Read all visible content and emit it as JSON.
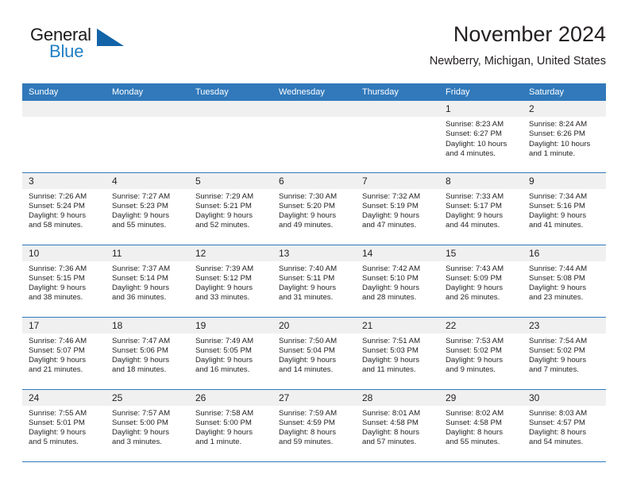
{
  "brand": {
    "name_part1": "General",
    "name_part2": "Blue",
    "logo_icon": "triangle-logo-icon"
  },
  "header": {
    "title": "November 2024",
    "subtitle": "Newberry, Michigan, United States"
  },
  "colors": {
    "header_blue": "#3179bb",
    "logo_blue": "#1263a8",
    "brand_blue_text": "#1f7fc4",
    "daynum_band": "#f0f0f0",
    "text": "#231f20"
  },
  "calendar": {
    "weekday_headers": [
      "Sunday",
      "Monday",
      "Tuesday",
      "Wednesday",
      "Thursday",
      "Friday",
      "Saturday"
    ],
    "labels": {
      "sunrise": "Sunrise:",
      "sunset": "Sunset:",
      "daylight": "Daylight:"
    },
    "weeks": [
      [
        {
          "day": "",
          "blank": true
        },
        {
          "day": "",
          "blank": true
        },
        {
          "day": "",
          "blank": true
        },
        {
          "day": "",
          "blank": true
        },
        {
          "day": "",
          "blank": true
        },
        {
          "day": "1",
          "sunrise": "Sunrise: 8:23 AM",
          "sunset": "Sunset: 6:27 PM",
          "daylight_line1": "Daylight: 10 hours",
          "daylight_line2": "and 4 minutes."
        },
        {
          "day": "2",
          "sunrise": "Sunrise: 8:24 AM",
          "sunset": "Sunset: 6:26 PM",
          "daylight_line1": "Daylight: 10 hours",
          "daylight_line2": "and 1 minute."
        }
      ],
      [
        {
          "day": "3",
          "sunrise": "Sunrise: 7:26 AM",
          "sunset": "Sunset: 5:24 PM",
          "daylight_line1": "Daylight: 9 hours",
          "daylight_line2": "and 58 minutes."
        },
        {
          "day": "4",
          "sunrise": "Sunrise: 7:27 AM",
          "sunset": "Sunset: 5:23 PM",
          "daylight_line1": "Daylight: 9 hours",
          "daylight_line2": "and 55 minutes."
        },
        {
          "day": "5",
          "sunrise": "Sunrise: 7:29 AM",
          "sunset": "Sunset: 5:21 PM",
          "daylight_line1": "Daylight: 9 hours",
          "daylight_line2": "and 52 minutes."
        },
        {
          "day": "6",
          "sunrise": "Sunrise: 7:30 AM",
          "sunset": "Sunset: 5:20 PM",
          "daylight_line1": "Daylight: 9 hours",
          "daylight_line2": "and 49 minutes."
        },
        {
          "day": "7",
          "sunrise": "Sunrise: 7:32 AM",
          "sunset": "Sunset: 5:19 PM",
          "daylight_line1": "Daylight: 9 hours",
          "daylight_line2": "and 47 minutes."
        },
        {
          "day": "8",
          "sunrise": "Sunrise: 7:33 AM",
          "sunset": "Sunset: 5:17 PM",
          "daylight_line1": "Daylight: 9 hours",
          "daylight_line2": "and 44 minutes."
        },
        {
          "day": "9",
          "sunrise": "Sunrise: 7:34 AM",
          "sunset": "Sunset: 5:16 PM",
          "daylight_line1": "Daylight: 9 hours",
          "daylight_line2": "and 41 minutes."
        }
      ],
      [
        {
          "day": "10",
          "sunrise": "Sunrise: 7:36 AM",
          "sunset": "Sunset: 5:15 PM",
          "daylight_line1": "Daylight: 9 hours",
          "daylight_line2": "and 38 minutes."
        },
        {
          "day": "11",
          "sunrise": "Sunrise: 7:37 AM",
          "sunset": "Sunset: 5:14 PM",
          "daylight_line1": "Daylight: 9 hours",
          "daylight_line2": "and 36 minutes."
        },
        {
          "day": "12",
          "sunrise": "Sunrise: 7:39 AM",
          "sunset": "Sunset: 5:12 PM",
          "daylight_line1": "Daylight: 9 hours",
          "daylight_line2": "and 33 minutes."
        },
        {
          "day": "13",
          "sunrise": "Sunrise: 7:40 AM",
          "sunset": "Sunset: 5:11 PM",
          "daylight_line1": "Daylight: 9 hours",
          "daylight_line2": "and 31 minutes."
        },
        {
          "day": "14",
          "sunrise": "Sunrise: 7:42 AM",
          "sunset": "Sunset: 5:10 PM",
          "daylight_line1": "Daylight: 9 hours",
          "daylight_line2": "and 28 minutes."
        },
        {
          "day": "15",
          "sunrise": "Sunrise: 7:43 AM",
          "sunset": "Sunset: 5:09 PM",
          "daylight_line1": "Daylight: 9 hours",
          "daylight_line2": "and 26 minutes."
        },
        {
          "day": "16",
          "sunrise": "Sunrise: 7:44 AM",
          "sunset": "Sunset: 5:08 PM",
          "daylight_line1": "Daylight: 9 hours",
          "daylight_line2": "and 23 minutes."
        }
      ],
      [
        {
          "day": "17",
          "sunrise": "Sunrise: 7:46 AM",
          "sunset": "Sunset: 5:07 PM",
          "daylight_line1": "Daylight: 9 hours",
          "daylight_line2": "and 21 minutes."
        },
        {
          "day": "18",
          "sunrise": "Sunrise: 7:47 AM",
          "sunset": "Sunset: 5:06 PM",
          "daylight_line1": "Daylight: 9 hours",
          "daylight_line2": "and 18 minutes."
        },
        {
          "day": "19",
          "sunrise": "Sunrise: 7:49 AM",
          "sunset": "Sunset: 5:05 PM",
          "daylight_line1": "Daylight: 9 hours",
          "daylight_line2": "and 16 minutes."
        },
        {
          "day": "20",
          "sunrise": "Sunrise: 7:50 AM",
          "sunset": "Sunset: 5:04 PM",
          "daylight_line1": "Daylight: 9 hours",
          "daylight_line2": "and 14 minutes."
        },
        {
          "day": "21",
          "sunrise": "Sunrise: 7:51 AM",
          "sunset": "Sunset: 5:03 PM",
          "daylight_line1": "Daylight: 9 hours",
          "daylight_line2": "and 11 minutes."
        },
        {
          "day": "22",
          "sunrise": "Sunrise: 7:53 AM",
          "sunset": "Sunset: 5:02 PM",
          "daylight_line1": "Daylight: 9 hours",
          "daylight_line2": "and 9 minutes."
        },
        {
          "day": "23",
          "sunrise": "Sunrise: 7:54 AM",
          "sunset": "Sunset: 5:02 PM",
          "daylight_line1": "Daylight: 9 hours",
          "daylight_line2": "and 7 minutes."
        }
      ],
      [
        {
          "day": "24",
          "sunrise": "Sunrise: 7:55 AM",
          "sunset": "Sunset: 5:01 PM",
          "daylight_line1": "Daylight: 9 hours",
          "daylight_line2": "and 5 minutes."
        },
        {
          "day": "25",
          "sunrise": "Sunrise: 7:57 AM",
          "sunset": "Sunset: 5:00 PM",
          "daylight_line1": "Daylight: 9 hours",
          "daylight_line2": "and 3 minutes."
        },
        {
          "day": "26",
          "sunrise": "Sunrise: 7:58 AM",
          "sunset": "Sunset: 5:00 PM",
          "daylight_line1": "Daylight: 9 hours",
          "daylight_line2": "and 1 minute."
        },
        {
          "day": "27",
          "sunrise": "Sunrise: 7:59 AM",
          "sunset": "Sunset: 4:59 PM",
          "daylight_line1": "Daylight: 8 hours",
          "daylight_line2": "and 59 minutes."
        },
        {
          "day": "28",
          "sunrise": "Sunrise: 8:01 AM",
          "sunset": "Sunset: 4:58 PM",
          "daylight_line1": "Daylight: 8 hours",
          "daylight_line2": "and 57 minutes."
        },
        {
          "day": "29",
          "sunrise": "Sunrise: 8:02 AM",
          "sunset": "Sunset: 4:58 PM",
          "daylight_line1": "Daylight: 8 hours",
          "daylight_line2": "and 55 minutes."
        },
        {
          "day": "30",
          "sunrise": "Sunrise: 8:03 AM",
          "sunset": "Sunset: 4:57 PM",
          "daylight_line1": "Daylight: 8 hours",
          "daylight_line2": "and 54 minutes."
        }
      ]
    ]
  }
}
